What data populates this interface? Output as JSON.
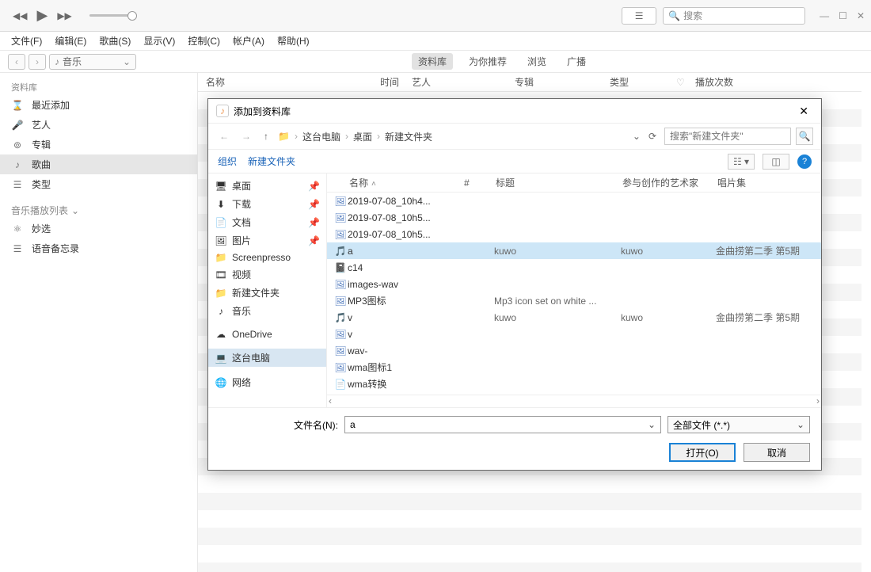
{
  "topbar": {
    "search_placeholder": "搜索"
  },
  "menu": [
    "文件(F)",
    "编辑(E)",
    "歌曲(S)",
    "显示(V)",
    "控制(C)",
    "帐户(A)",
    "帮助(H)"
  ],
  "media_selector": "音乐",
  "center_tabs": [
    "资料库",
    "为你推荐",
    "浏览",
    "广播"
  ],
  "columns": {
    "name": "名称",
    "time": "时间",
    "artist": "艺人",
    "album": "专辑",
    "type": "类型",
    "plays": "播放次数"
  },
  "sidebar": {
    "section1": "资料库",
    "items1": [
      {
        "label": "最近添加",
        "icon": "clock"
      },
      {
        "label": "艺人",
        "icon": "mic"
      },
      {
        "label": "专辑",
        "icon": "disc"
      },
      {
        "label": "歌曲",
        "icon": "note",
        "active": true
      },
      {
        "label": "类型",
        "icon": "list"
      }
    ],
    "section2": "音乐播放列表",
    "items2": [
      {
        "label": "妙选",
        "icon": "atom"
      },
      {
        "label": "语音备忘录",
        "icon": "list"
      }
    ]
  },
  "dialog": {
    "title": "添加到资料库",
    "breadcrumb": [
      "这台电脑",
      "桌面",
      "新建文件夹"
    ],
    "search_placeholder": "搜索\"新建文件夹\"",
    "toolbar": {
      "organize": "组织",
      "newfolder": "新建文件夹"
    },
    "tree": [
      {
        "label": "桌面",
        "icon": "desktop",
        "pin": true
      },
      {
        "label": "下载",
        "icon": "download",
        "pin": true
      },
      {
        "label": "文档",
        "icon": "doc",
        "pin": true
      },
      {
        "label": "图片",
        "icon": "image",
        "pin": true
      },
      {
        "label": "Screenpresso",
        "icon": "folder"
      },
      {
        "label": "视频",
        "icon": "video"
      },
      {
        "label": "新建文件夹",
        "icon": "folder"
      },
      {
        "label": "音乐",
        "icon": "note"
      },
      {
        "label": "OneDrive",
        "icon": "cloud",
        "gap": true
      },
      {
        "label": "这台电脑",
        "icon": "pc",
        "gap": true,
        "sel": true
      },
      {
        "label": "网络",
        "icon": "net",
        "gap": true
      }
    ],
    "file_head": {
      "name": "名称",
      "num": "#",
      "title": "标题",
      "artist": "参与创作的艺术家",
      "album": "唱片集"
    },
    "files": [
      {
        "name": "2019-07-08_10h4...",
        "icon": "img"
      },
      {
        "name": "2019-07-08_10h5...",
        "icon": "img"
      },
      {
        "name": "2019-07-08_10h5...",
        "icon": "img"
      },
      {
        "name": "a",
        "icon": "audio",
        "title": "kuwo",
        "artist": "kuwo",
        "album": "金曲捞第二季 第5期",
        "sel": true
      },
      {
        "name": "c14",
        "icon": "one"
      },
      {
        "name": "images-wav",
        "icon": "img"
      },
      {
        "name": "MP3图标",
        "icon": "img",
        "title": "Mp3 icon set on white ..."
      },
      {
        "name": "v",
        "icon": "audio",
        "title": "kuwo",
        "artist": "kuwo",
        "album": "金曲捞第二季 第5期"
      },
      {
        "name": "v",
        "icon": "img"
      },
      {
        "name": "wav-",
        "icon": "img"
      },
      {
        "name": "wma图标1",
        "icon": "img"
      },
      {
        "name": "wma转换",
        "icon": "file"
      }
    ],
    "filename_label": "文件名(N):",
    "filename_value": "a",
    "filter": "全部文件 (*.*)",
    "open_btn": "打开(O)",
    "cancel_btn": "取消"
  }
}
